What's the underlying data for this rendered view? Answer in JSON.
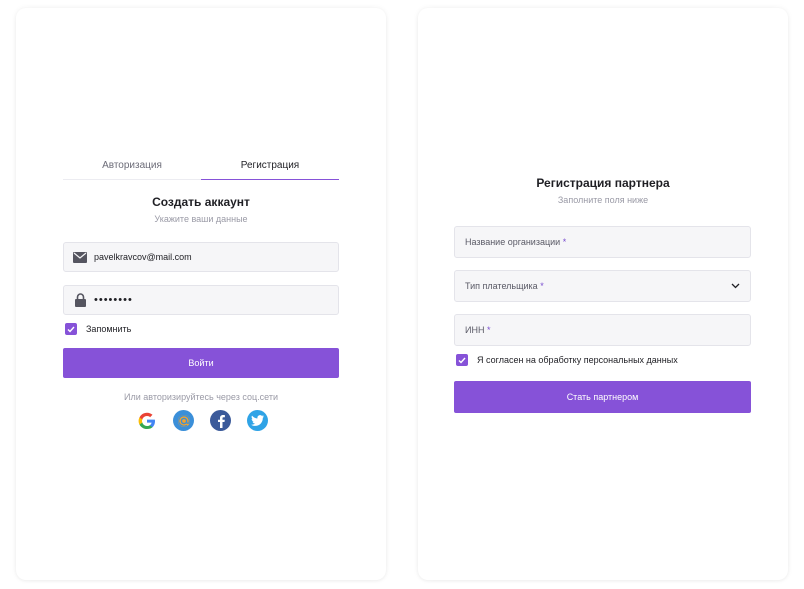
{
  "login": {
    "tabs": [
      {
        "label": "Авторизация",
        "active": false
      },
      {
        "label": "Регистрация",
        "active": true
      }
    ],
    "title": "Создать аккаунт",
    "subtitle": "Укажите ваши данные",
    "email": {
      "value": "pavelkravcov@mail.com",
      "icon": "mail-icon"
    },
    "password": {
      "value": "••••••••",
      "icon": "lock-icon"
    },
    "remember_label": "Запомнить",
    "remember_checked": true,
    "submit_label": "Войти",
    "social_hint": "Или авторизируйтесь через соц.сети",
    "socials": [
      "google-icon",
      "mail-ru-icon",
      "facebook-icon",
      "twitter-icon"
    ]
  },
  "partner": {
    "title": "Регистрация партнера",
    "subtitle": "Заполните поля ниже",
    "org_name_label": "Название организации",
    "payer_type_label": "Тип плательщика",
    "inn_label": "ИНН",
    "required_mark": "*",
    "consent_label": "Я согласен на обработку персональных данных",
    "consent_checked": true,
    "submit_label": "Стать партнером"
  },
  "colors": {
    "accent": "#8652d8",
    "field_bg": "#f6f6f8",
    "muted_text": "#9a9aa6"
  }
}
